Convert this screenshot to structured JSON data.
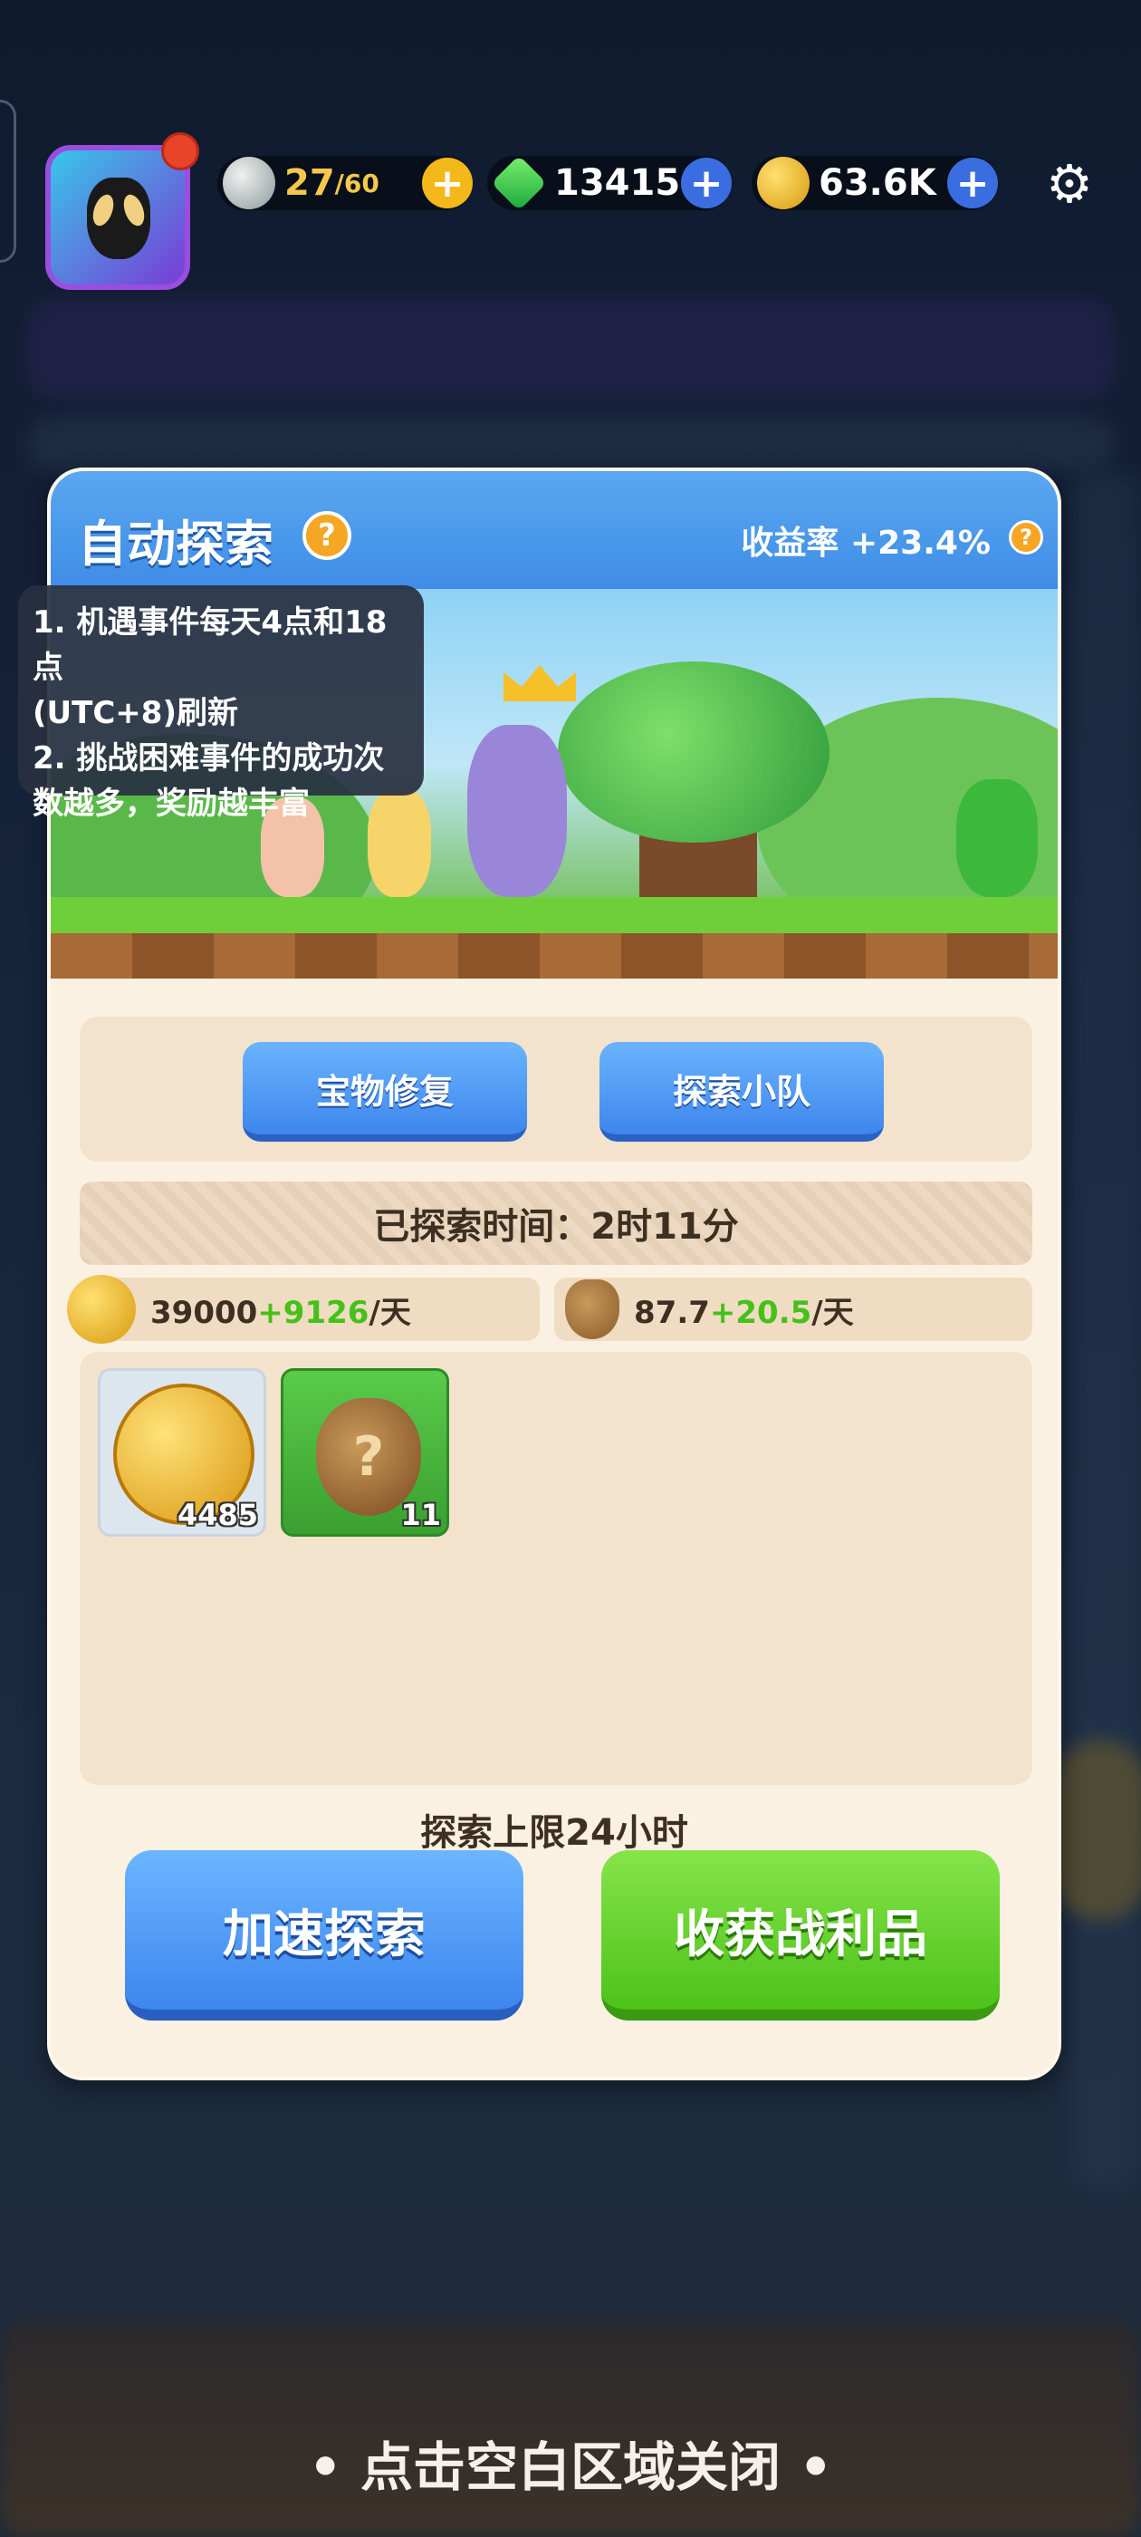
{
  "top_bar": {
    "stamina": {
      "value": "27",
      "max": "/60",
      "icon": "stamina-orb-icon"
    },
    "gems": {
      "value": "13415",
      "icon": "green-gem-icon"
    },
    "coins": {
      "value": "63.6K",
      "icon": "gold-coin-icon"
    },
    "settings_icon": "gear-icon"
  },
  "panel": {
    "title": "自动探索",
    "rate_label": "收益率 +23.4%",
    "tooltip": {
      "line1": "1. 机遇事件每天4点和18点",
      "line2": "(UTC+8)刷新",
      "line3": "2. 挑战困难事件的成功次",
      "line4": "数越多，奖励越丰富"
    },
    "treasure_repair_label": "宝物修复",
    "explore_team_label": "探索小队",
    "explored_time": "已探索时间：2时11分",
    "coin_rate": {
      "base": "39000",
      "bonus": "+9126",
      "unit": "/天"
    },
    "bag_rate": {
      "base": "87.7",
      "bonus": "+20.5",
      "unit": "/天"
    },
    "loot": [
      {
        "name": "gold-crown-coin",
        "count": "4485"
      },
      {
        "name": "mystery-bag",
        "count": "11"
      }
    ],
    "limit_text": "探索上限24小时",
    "speed_up_label": "加速探索",
    "collect_label": "收获战利品"
  },
  "close_hint": "• 点击空白区域关闭 •",
  "colors": {
    "accent_blue": "#3f8ce6",
    "accent_green": "#4cc21a",
    "panel_bg": "#fbf1e2",
    "bonus_green": "#45c11a"
  }
}
